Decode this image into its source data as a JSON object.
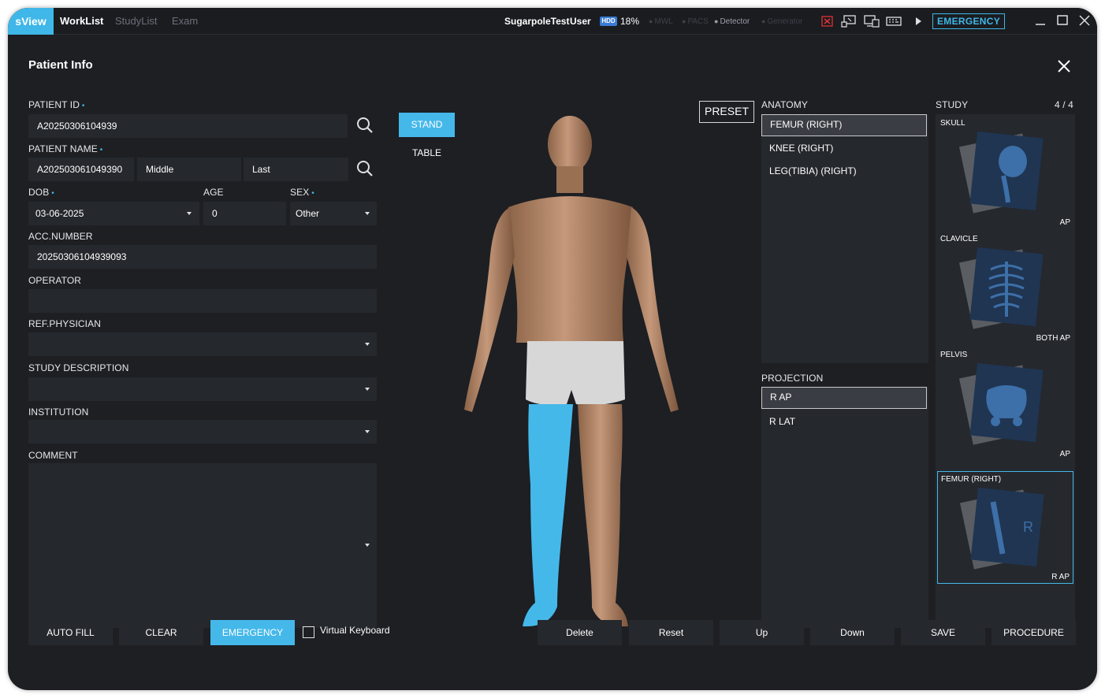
{
  "topbar": {
    "brand": "sView",
    "tabs": [
      "WorkList",
      "StudyList",
      "Exam"
    ],
    "active_tab": "WorkList",
    "hospital": "SugarpoleTest",
    "user": "User",
    "hdd_label": "HDD",
    "hdd_percent": "18%",
    "status": [
      {
        "label": "MWL",
        "on": false
      },
      {
        "label": "PACS",
        "on": false
      },
      {
        "label": "Detector",
        "on": true
      },
      {
        "label": "Generator",
        "on": false
      }
    ],
    "emergency_label": "EMERGENCY"
  },
  "panel": {
    "title": "Patient Info"
  },
  "form": {
    "patient_id_label": "PATIENT ID",
    "patient_id_value": "A20250306104939",
    "patient_name_label": "PATIENT NAME",
    "first_name_value": "A202503061049390",
    "middle_placeholder": "Middle",
    "last_placeholder": "Last",
    "dob_label": "DOB",
    "dob_value": "03-06-2025",
    "age_label": "AGE",
    "age_value": "0",
    "sex_label": "SEX",
    "sex_value": "Other",
    "acc_label": "ACC.NUMBER",
    "acc_value": "20250306104939093",
    "operator_label": "OPERATOR",
    "operator_value": "",
    "ref_label": "REF.PHYSICIAN",
    "ref_value": "",
    "study_desc_label": "STUDY DESCRIPTION",
    "study_desc_value": "",
    "institution_label": "INSTITUTION",
    "institution_value": "",
    "comment_label": "COMMENT",
    "comment_value": ""
  },
  "body": {
    "stand_label": "STAND",
    "table_label": "TABLE",
    "highlight_color": "#45b8ea"
  },
  "anatomy": {
    "preset_label": "PRESET",
    "title": "ANATOMY",
    "items": [
      "FEMUR (RIGHT)",
      "KNEE (RIGHT)",
      "LEG(TIBIA) (RIGHT)"
    ],
    "selected_index": 0
  },
  "projection": {
    "title": "PROJECTION",
    "items": [
      "R AP",
      "R LAT"
    ],
    "selected_index": 0
  },
  "study": {
    "title": "STUDY",
    "count": "4 / 4",
    "cards": [
      {
        "name": "SKULL",
        "projection": "AP"
      },
      {
        "name": "CLAVICLE",
        "projection": "BOTH AP"
      },
      {
        "name": "PELVIS",
        "projection": "AP"
      },
      {
        "name": "FEMUR (RIGHT)",
        "projection": "R AP"
      }
    ]
  },
  "buttons": {
    "auto_fill": "AUTO FILL",
    "clear": "CLEAR",
    "emergency": "EMERGENCY",
    "virtual_keyboard": "Virtual Keyboard",
    "delete": "Delete",
    "reset": "Reset",
    "up": "Up",
    "down": "Down",
    "save": "SAVE",
    "procedure": "PROCEDURE"
  },
  "colors": {
    "accent": "#45b8ea",
    "background": "#1d1f23",
    "field": "#25282d"
  }
}
